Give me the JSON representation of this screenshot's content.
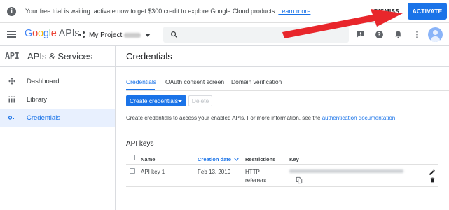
{
  "banner": {
    "message": "Your free trial is waiting: activate now to get $300 credit to explore Google Cloud products.",
    "link": "Learn more",
    "dismiss": "DISMISS",
    "activate": "ACTIVATE"
  },
  "topbar": {
    "logo_apis": "APIs",
    "project_name": "My Project"
  },
  "sidebar": {
    "mark": "API",
    "title": "APIs & Services",
    "items": [
      {
        "label": "Dashboard",
        "icon": "dashboard-icon"
      },
      {
        "label": "Library",
        "icon": "library-icon"
      },
      {
        "label": "Credentials",
        "icon": "key-icon",
        "active": true
      }
    ]
  },
  "main": {
    "title": "Credentials",
    "tabs": [
      {
        "label": "Credentials",
        "active": true
      },
      {
        "label": "OAuth consent screen"
      },
      {
        "label": "Domain verification"
      }
    ],
    "create_button": "Create credentials",
    "delete_button": "Delete",
    "description": "Create credentials to access your enabled APIs. For more information, see the",
    "description_link": "authentication documentation",
    "description_end": ".",
    "section_title": "API keys",
    "table": {
      "headers": [
        "Name",
        "Creation date",
        "Restrictions",
        "Key"
      ],
      "rows": [
        {
          "name": "API key 1",
          "date": "Feb 13, 2019",
          "restrictions_line1": "HTTP",
          "restrictions_line2": "referrers"
        }
      ]
    }
  },
  "colors": {
    "accent": "#1a73e8",
    "annotation_arrow": "#e8262b"
  }
}
